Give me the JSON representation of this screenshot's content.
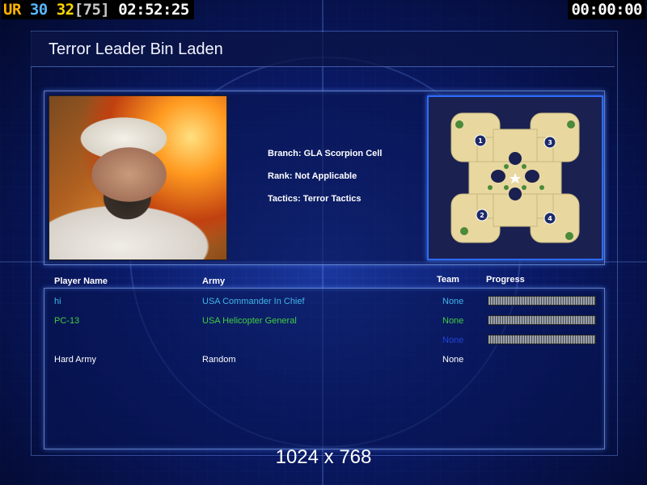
{
  "hud": {
    "ur_label": "UR",
    "v1": "30",
    "v2": "32",
    "v3": "[75]",
    "clock": "02:52:25",
    "timer": "00:00:00"
  },
  "title": "Terror Leader Bin Laden",
  "info": {
    "branch": "Branch: GLA Scorpion Cell",
    "rank": "Rank: Not Applicable",
    "tactics": "Tactics: Terror Tactics"
  },
  "map": {
    "start_positions": [
      "1",
      "2",
      "3",
      "4"
    ]
  },
  "table": {
    "headers": {
      "player": "Player Name",
      "army": "Army",
      "team": "Team",
      "progress": "Progress"
    },
    "rows": [
      {
        "name": "hi",
        "army": "USA Commander In Chief",
        "team": "None",
        "color": "#3fb6e8",
        "show_bar": true,
        "progress": 0
      },
      {
        "name": "PC-13",
        "army": "USA Helicopter General",
        "team": "None",
        "color": "#3fcf3f",
        "show_bar": true,
        "progress": 0
      },
      {
        "name": "",
        "army": "",
        "team": "None",
        "color": "#2440d8",
        "show_bar": true,
        "progress": 0
      },
      {
        "name": "Hard Army",
        "army": "Random",
        "team": "None",
        "color": "#ffffff",
        "show_bar": false,
        "progress": 0
      }
    ]
  },
  "resolution": "1024 x 768",
  "colors": {
    "ur": "#ffb000",
    "v1": "#58b8ff",
    "v2": "#ffd800",
    "v3": "#c8c8c8",
    "accent_border": "#2c6cff"
  }
}
